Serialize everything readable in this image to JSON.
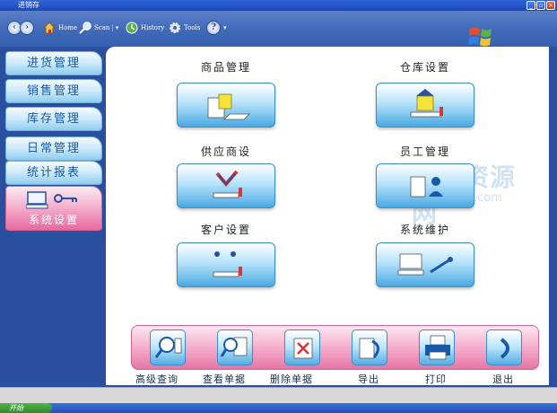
{
  "window": {
    "title": "进销存"
  },
  "toolbar": {
    "home_label": "Home",
    "scan_label": "Scan",
    "history_label": "History",
    "tools_label": "Tools",
    "help_glyph": "?"
  },
  "sidebar": {
    "items": [
      {
        "label": "进货管理"
      },
      {
        "label": "销售管理"
      },
      {
        "label": "库存管理"
      },
      {
        "label": "日常管理"
      },
      {
        "label": "统计报表"
      },
      {
        "label": "系统设置",
        "active": true
      }
    ]
  },
  "modules": [
    {
      "label": "商品管理",
      "icon": "product-icon"
    },
    {
      "label": "仓库设置",
      "icon": "warehouse-icon"
    },
    {
      "label": "供应商设",
      "icon": "supplier-icon"
    },
    {
      "label": "员工管理",
      "icon": "employee-icon"
    },
    {
      "label": "客户设置",
      "icon": "customer-icon"
    },
    {
      "label": "系统维护",
      "icon": "maintenance-icon"
    }
  ],
  "watermark": {
    "title": "数码资源网",
    "url": "www.smzy.com"
  },
  "actions": [
    {
      "label": "高级查询",
      "icon": "advanced-search-icon"
    },
    {
      "label": "查看单据",
      "icon": "view-document-icon"
    },
    {
      "label": "删除单据",
      "icon": "delete-document-icon"
    },
    {
      "label": "导出",
      "icon": "export-icon"
    },
    {
      "label": "打印",
      "icon": "printer-icon"
    },
    {
      "label": "退出",
      "icon": "exit-icon"
    }
  ],
  "taskbar": {
    "start_label": "开始"
  },
  "colors": {
    "accent_blue": "#4aa9e3",
    "accent_pink": "#e576a5",
    "frame": "#2a4f9e"
  }
}
